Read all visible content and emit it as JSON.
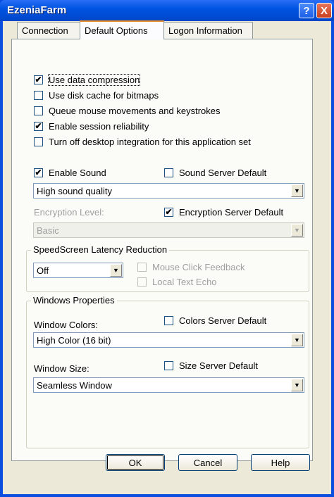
{
  "window": {
    "title": "EzeniaFarm"
  },
  "titlebar": {
    "help_glyph": "?",
    "close_glyph": "X"
  },
  "tabs": [
    {
      "label": "Connection"
    },
    {
      "label": "Default Options"
    },
    {
      "label": "Logon Information"
    }
  ],
  "options": {
    "use_compression": {
      "label": "Use data compression",
      "checked": true
    },
    "disk_cache": {
      "label": "Use disk cache for bitmaps",
      "checked": false
    },
    "queue_mouse": {
      "label": "Queue mouse movements and keystrokes",
      "checked": false
    },
    "session_reliability": {
      "label": "Enable session reliability",
      "checked": true
    },
    "desktop_integration": {
      "label": "Turn off desktop integration for this application set",
      "checked": false
    }
  },
  "sound": {
    "enable_label": "Enable Sound",
    "enable_checked": true,
    "server_default_label": "Sound Server Default",
    "server_default_checked": false,
    "quality_value": "High sound quality"
  },
  "encryption": {
    "level_label": "Encryption Level:",
    "server_default_label": "Encryption Server Default",
    "server_default_checked": true,
    "level_value": "Basic"
  },
  "speedscreen": {
    "group_label": "SpeedScreen Latency Reduction",
    "mode_value": "Off",
    "mouse_click_label": "Mouse Click Feedback",
    "local_echo_label": "Local Text Echo"
  },
  "windows": {
    "group_label": "Windows Properties",
    "colors_label": "Window Colors:",
    "colors_server_default_label": "Colors Server Default",
    "colors_value": "High Color (16 bit)",
    "size_label": "Window Size:",
    "size_server_default_label": "Size Server Default",
    "size_value": "Seamless Window"
  },
  "buttons": {
    "ok": "OK",
    "cancel": "Cancel",
    "help": "Help"
  },
  "glyphs": {
    "check": "✔",
    "arrow": "▼"
  },
  "colors": {
    "titlebar": "#0054e3",
    "dialog": "#ece9d8",
    "tab_highlight": "#e68b2c"
  }
}
